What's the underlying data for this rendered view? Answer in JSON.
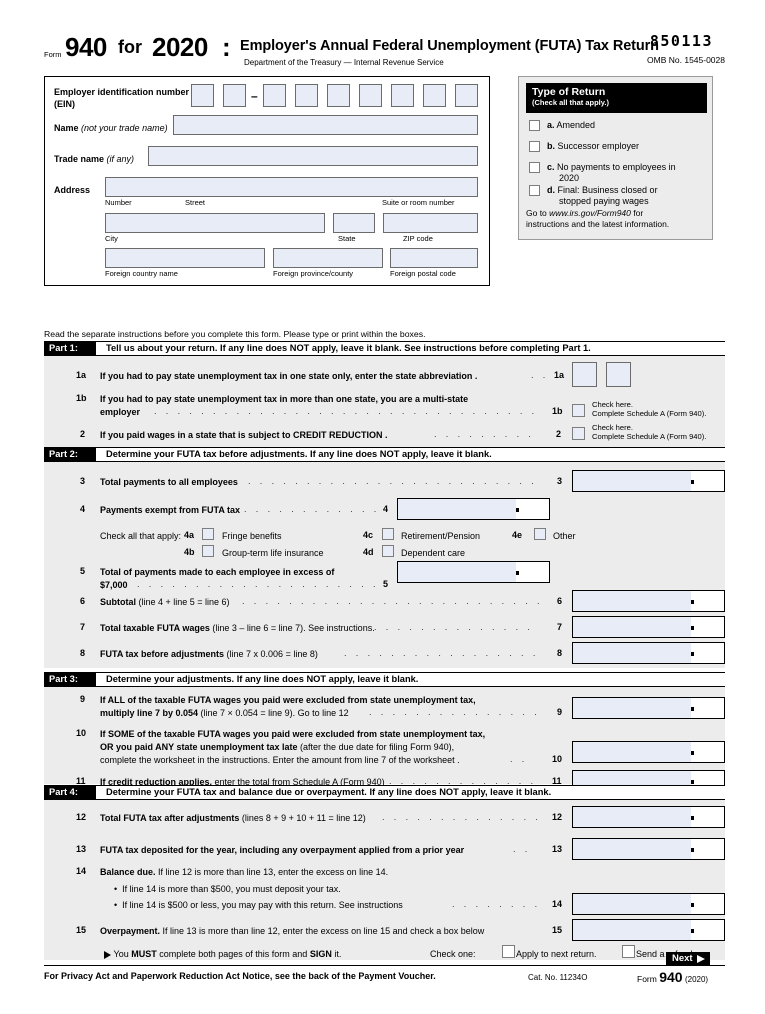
{
  "header": {
    "form_label": "Form",
    "form_number": "940",
    "for_word": "for",
    "year": "2020",
    "colon": ":",
    "title": "Employer's Annual Federal Unemployment (FUTA) Tax Return",
    "department": "Department of the Treasury  —  Internal Revenue Service",
    "ocr_number": "850113",
    "omb": "OMB No. 1545-0028"
  },
  "identity": {
    "ein_label_l1": "Employer identification number",
    "ein_label_l2": "(EIN)",
    "ein_dash": "–",
    "name_label": "Name",
    "name_label_italic": "(not your trade name)",
    "trade_label": "Trade name",
    "trade_label_italic": "(if any)",
    "address_label": "Address",
    "sub_number": "Number",
    "sub_street": "Street",
    "sub_suite": "Suite or room number",
    "sub_city": "City",
    "sub_state": "State",
    "sub_zip": "ZIP code",
    "sub_country": "Foreign country name",
    "sub_province": "Foreign province/county",
    "sub_postal": "Foreign postal code"
  },
  "type_of_return": {
    "heading": "Type of Return",
    "subheading": "(Check all that apply.)",
    "options": [
      {
        "marker": "a.",
        "label": "Amended"
      },
      {
        "marker": "b.",
        "label": "Successor employer"
      },
      {
        "marker": "c.",
        "label": "No payments to employees in",
        "label2": "2020"
      },
      {
        "marker": "d.",
        "label": "Final: Business closed or",
        "label2": "stopped paying wages"
      }
    ],
    "goto_pre": "Go to ",
    "goto_url": "www.irs.gov/Form940",
    "goto_post": " for",
    "goto_line2": "instructions and the latest information."
  },
  "read_instructions": "Read the separate instructions before you complete this form. Please type or print within the boxes.",
  "parts": {
    "part1": {
      "tag": "Part 1:",
      "title": "Tell us about your return. If any line does NOT apply, leave it blank. See instructions before completing Part 1."
    },
    "part2": {
      "tag": "Part 2:",
      "title": "Determine your FUTA tax before adjustments. If any line does NOT apply, leave it blank."
    },
    "part3": {
      "tag": "Part 3:",
      "title": "Determine your adjustments. If any line does NOT apply, leave it blank."
    },
    "part4": {
      "tag": "Part 4:",
      "title": "Determine your FUTA tax and balance due or overpayment. If any line does NOT apply, leave it blank."
    }
  },
  "lines": {
    "l1a": {
      "num": "1a",
      "text": "If you had to pay state unemployment tax in one state only, enter the state abbreviation .",
      "ref": "1a"
    },
    "l1b": {
      "num": "1b",
      "text_l1": "If you had to pay state unemployment tax in more than one state, you are a multi-state",
      "text_l2": "employer",
      "ref": "1b",
      "check_l1": "Check here.",
      "check_l2": "Complete Schedule A (Form 940)."
    },
    "l2": {
      "num": "2",
      "text": "If you paid wages in a state that is subject to CREDIT REDUCTION .",
      "ref": "2",
      "check_l1": "Check here.",
      "check_l2": "Complete Schedule A (Form 940)."
    },
    "l3": {
      "num": "3",
      "text": "Total payments to all employees",
      "ref": "3"
    },
    "l4": {
      "num": "4",
      "text": "Payments exempt from FUTA tax",
      "ref": "4",
      "check_all_label": "Check all that apply:",
      "boxes": [
        {
          "marker": "4a",
          "label": "Fringe benefits"
        },
        {
          "marker": "4b",
          "label": "Group-term life insurance"
        },
        {
          "marker": "4c",
          "label": "Retirement/Pension"
        },
        {
          "marker": "4d",
          "label": "Dependent care"
        },
        {
          "marker": "4e",
          "label": "Other"
        }
      ]
    },
    "l5": {
      "num": "5",
      "text_l1": "Total of payments made to each employee in excess of",
      "text_l2": "$7,000",
      "ref": "5"
    },
    "l6": {
      "num": "6",
      "text_b": "Subtotal",
      "text_n": " (line 4 + line 5 = line 6)",
      "ref": "6"
    },
    "l7": {
      "num": "7",
      "text_b": "Total taxable FUTA wages",
      "text_n": " (line 3 – line 6 = line 7). See instructions.",
      "ref": "7"
    },
    "l8": {
      "num": "8",
      "text_b": "FUTA tax before adjustments",
      "text_n": " (line 7 x 0.006 = line 8)",
      "ref": "8"
    },
    "l9": {
      "num": "9",
      "text_l1": "If ALL of the taxable FUTA wages you paid were excluded from state unemployment tax,",
      "text_l2b": "multiply line 7 by 0.054",
      "text_l2n": "  (line 7 × 0.054 = line 9). Go to line 12",
      "ref": "9"
    },
    "l10": {
      "num": "10",
      "text_l1b": "If SOME of the taxable FUTA wages you paid were excluded from state unemployment tax,",
      "text_l2b": "OR you paid ANY state unemployment tax late",
      "text_l2n": " (after the due date for filing Form 940),",
      "text_l3": "complete the worksheet in the instructions. Enter the amount from line 7 of the worksheet .",
      "ref": "10"
    },
    "l11": {
      "num": "11",
      "text_b": "If credit reduction applies,",
      "text_n": " enter the total from Schedule A (Form 940)",
      "ref": "11"
    },
    "l12": {
      "num": "12",
      "text_b": "Total FUTA tax after adjustments",
      "text_n": " (lines 8 + 9 + 10 + 11 = line 12)",
      "ref": "12"
    },
    "l13": {
      "num": "13",
      "text": "FUTA tax deposited for the year, including any overpayment applied from a prior year",
      "ref": "13"
    },
    "l14": {
      "num": "14",
      "text_b": "Balance due.",
      "text_n": " If line 12 is more than line 13, enter the excess on line 14.",
      "bullet1": "If line 14 is more than $500, you must deposit your tax.",
      "bullet2": "If line 14 is $500 or less, you may pay with this return. See instructions",
      "ref": "14"
    },
    "l15": {
      "num": "15",
      "text_b": "Overpayment.",
      "text_n": " If line 13 is more than line 12, enter the excess on line 15 and check a box below",
      "ref": "15"
    }
  },
  "signline": {
    "text_pre": "You ",
    "must": "MUST",
    "text_mid": " complete both pages of this form and ",
    "sign": "SIGN",
    "text_post": " it.",
    "check_one": "Check one:",
    "opt1": "Apply to next return.",
    "opt2": "Send a refund."
  },
  "next_button": {
    "label": "Next"
  },
  "footer": {
    "privacy": "For Privacy Act and Paperwork Reduction Act Notice, see the back of the Payment Voucher.",
    "cat_no": "Cat. No. 11234O",
    "form_word": "Form",
    "form_number": "940",
    "form_year": "(2020)"
  }
}
